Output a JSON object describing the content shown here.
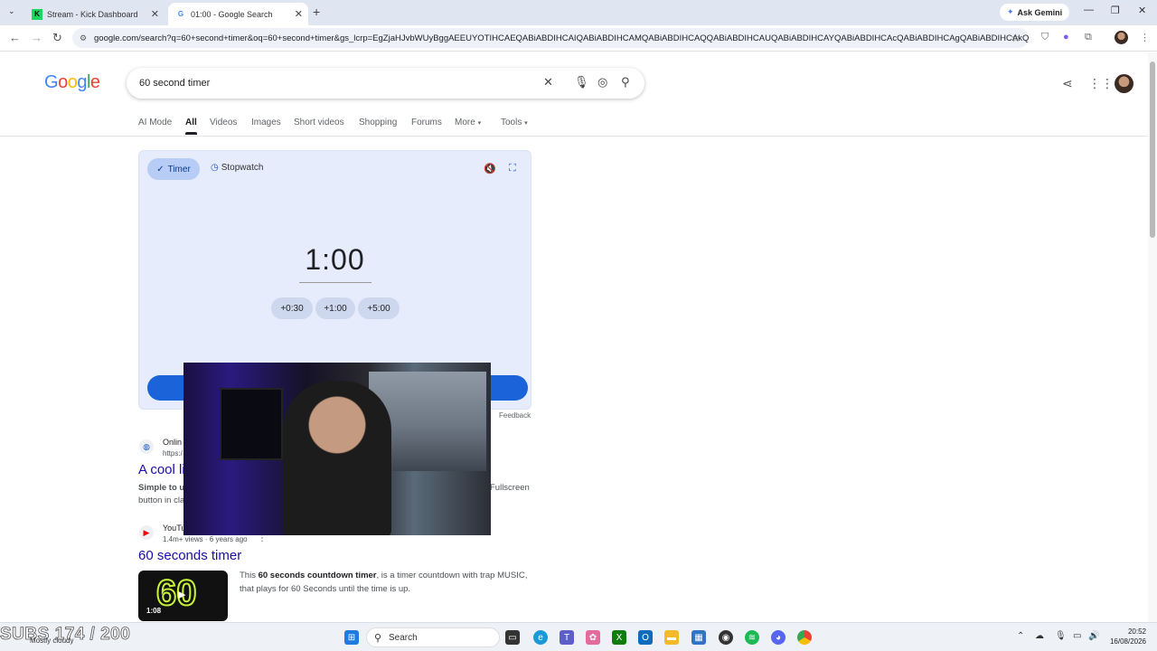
{
  "browser": {
    "tabs": [
      {
        "title": "Stream - Kick Dashboard",
        "icon": "kick-icon",
        "active": false
      },
      {
        "title": "01:00 - Google Search",
        "icon": "google-icon",
        "active": true
      }
    ],
    "new_tab": "+",
    "ask_gemini": "Ask Gemini",
    "url": "google.com/search?q=60+second+timer&oq=60+second+timer&gs_lcrp=EgZjaHJvbWUyBggAEEUYOTIHCAEQABiABDIHCAIQABiABDIHCAMQABiABDIHCAQQABiABDIHCAUQABiABDIHCAYQABiABDIHCAcQABiABDIHCAgQABiABDIHCAkQABiA..."
  },
  "google": {
    "logo": "Google",
    "query": "60 second timer",
    "tabs": [
      "AI Mode",
      "All",
      "Videos",
      "Images",
      "Short videos",
      "Shopping",
      "Forums",
      "More",
      "Tools"
    ],
    "active_tab": "All"
  },
  "timer": {
    "timer_label": "Timer",
    "stopwatch_label": "Stopwatch",
    "time": "1:00",
    "add_buttons": [
      "+0:30",
      "+1:00",
      "+5:00"
    ],
    "feedback": "Feedback",
    "accent": "#1a63d8"
  },
  "results": [
    {
      "source": "Onlin",
      "url": "https:/",
      "title": "A cool li",
      "snippet_bold": "Simple to u",
      "snippet_tail": "Fullscreen",
      "snippet_line2": "button in cla"
    },
    {
      "source": "YouTu",
      "meta": "1.4m+ views · 6 years ago",
      "title": "60 seconds timer",
      "snippet_pre": "This ",
      "snippet_bold": "60 seconds countdown timer",
      "snippet_post": ", is a timer countdown with trap MUSIC,",
      "snippet_line2": "that plays for 60 Seconds until the time is up.",
      "thumb_number": "60",
      "thumb_duration": "1:08"
    }
  ],
  "taskbar": {
    "search_label": "Search",
    "subs_overlay": "SUBS 174 / 200",
    "weather": "Mostly cloudy",
    "time": "20:52",
    "date": "16/08/2026"
  }
}
